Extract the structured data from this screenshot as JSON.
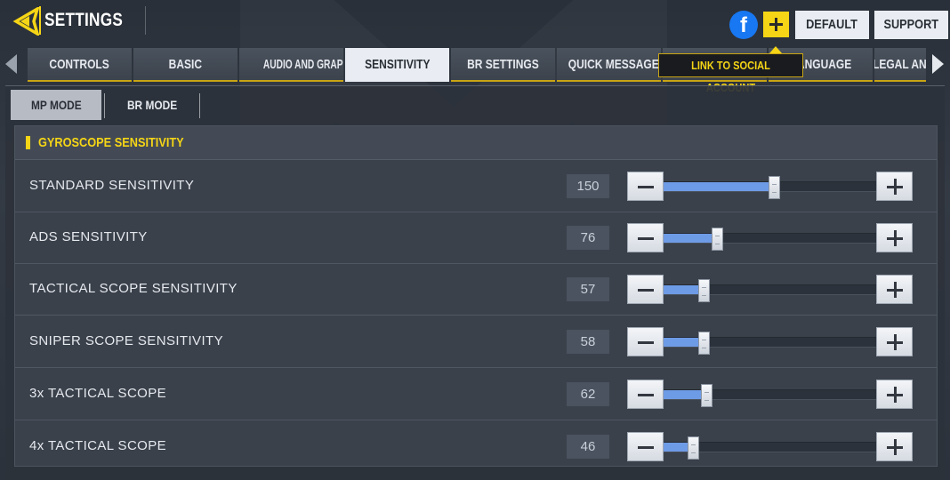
{
  "header": {
    "title": "SETTINGS",
    "default_label": "DEFAULT",
    "support_label": "SUPPORT"
  },
  "tabs": [
    {
      "label": "CONTROLS"
    },
    {
      "label": "BASIC"
    },
    {
      "label": "AUDIO AND GRAPHICS"
    },
    {
      "label": "SENSITIVITY",
      "active": true
    },
    {
      "label": "BR SETTINGS"
    },
    {
      "label": "QUICK MESSAGE"
    },
    {
      "label": ""
    },
    {
      "label": "LANGUAGE"
    },
    {
      "label": "LEGAL AND"
    }
  ],
  "tooltip": "LINK TO SOCIAL ACCOUNT",
  "modes": [
    {
      "label": "MP MODE",
      "active": true
    },
    {
      "label": "BR MODE",
      "active": false
    }
  ],
  "section": {
    "title": "GYROSCOPE SENSITIVITY",
    "rows": [
      {
        "label": "STANDARD SENSITIVITY",
        "value": "150",
        "fill": 0.52
      },
      {
        "label": "ADS SENSITIVITY",
        "value": "76",
        "fill": 0.25
      },
      {
        "label": "TACTICAL SCOPE SENSITIVITY",
        "value": "57",
        "fill": 0.19
      },
      {
        "label": "SNIPER SCOPE SENSITIVITY",
        "value": "58",
        "fill": 0.19
      },
      {
        "label": "3x TACTICAL SCOPE",
        "value": "62",
        "fill": 0.2
      },
      {
        "label": "4x TACTICAL SCOPE",
        "value": "46",
        "fill": 0.14
      }
    ]
  },
  "colors": {
    "accent": "#f5d516",
    "slider_fill": "#6e9be6",
    "facebook": "#1877f2"
  },
  "icons": {
    "back": "back-arrow-icon",
    "facebook": "facebook-icon",
    "add": "plus-icon",
    "tab_prev": "chevron-left-icon",
    "tab_next": "chevron-right-icon"
  }
}
